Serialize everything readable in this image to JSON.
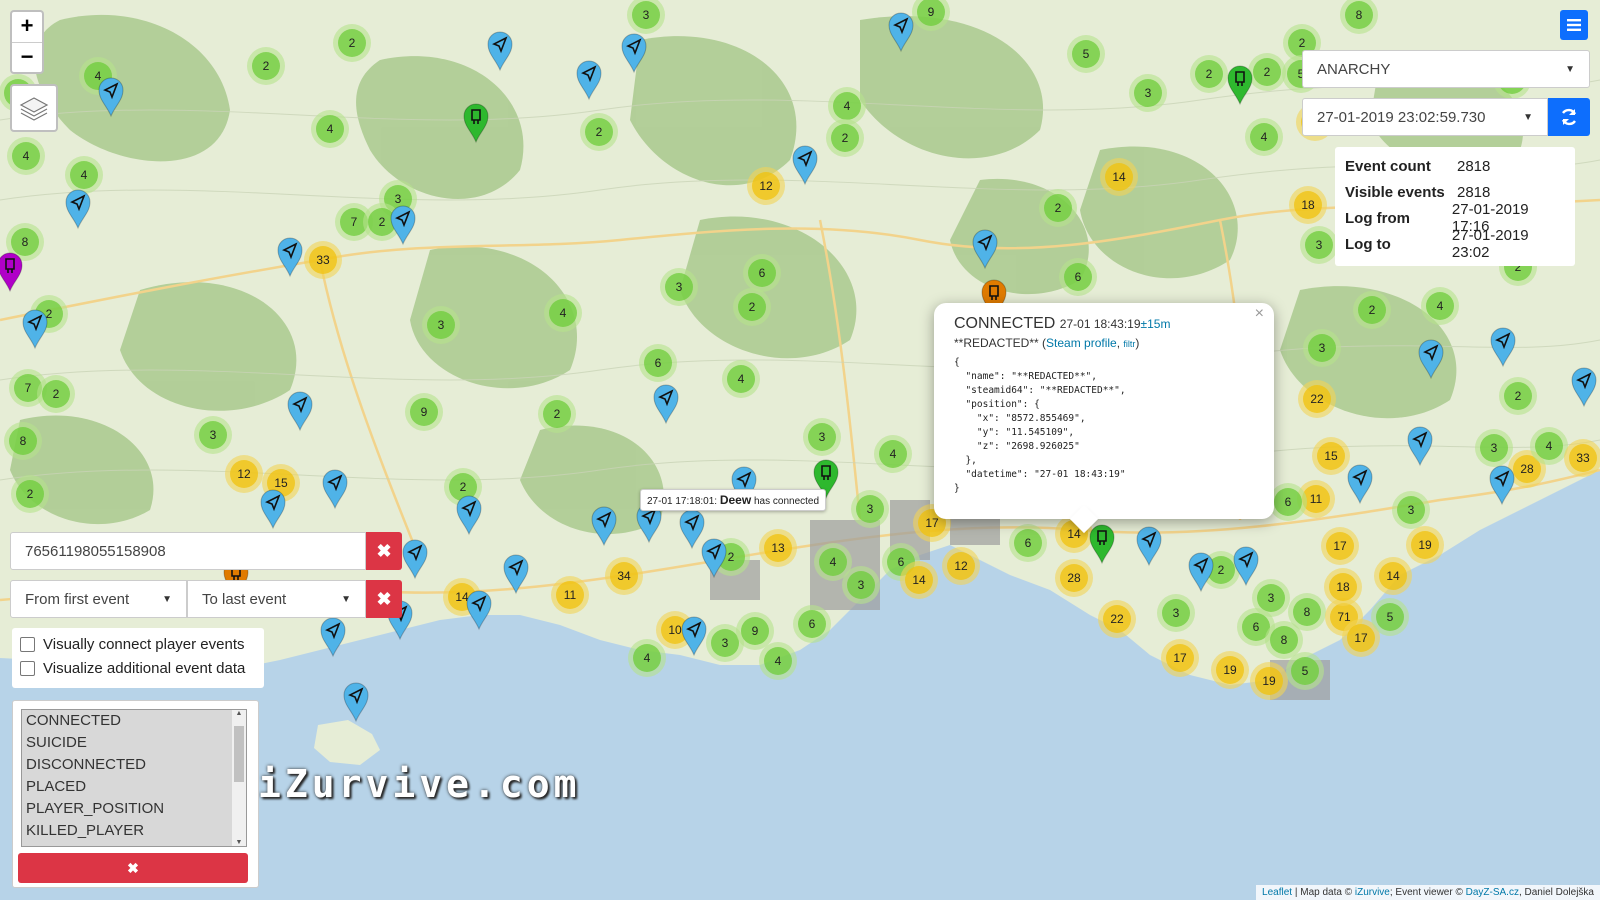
{
  "map": {
    "zoom_in": "+",
    "zoom_out": "−",
    "watermark": "iZurvive.com",
    "sea_color": "#b7d3e8",
    "land_color": "#e6edd6",
    "forest_color": "#a9c98e",
    "clusters": [
      {
        "n": "2"
      },
      {
        "n": "3"
      },
      {
        "n": "9"
      },
      {
        "n": "8"
      },
      {
        "n": "4"
      },
      {
        "n": "2"
      },
      {
        "n": "4"
      },
      {
        "n": "2"
      },
      {
        "n": "5"
      },
      {
        "n": "2"
      },
      {
        "n": "3"
      },
      {
        "n": "4"
      },
      {
        "n": "2"
      },
      {
        "n": "12"
      },
      {
        "n": "14"
      },
      {
        "n": "2"
      },
      {
        "n": "18"
      },
      {
        "n": "3"
      },
      {
        "n": "7"
      },
      {
        "n": "2"
      },
      {
        "n": "33"
      },
      {
        "n": "2"
      },
      {
        "n": "3"
      },
      {
        "n": "3"
      },
      {
        "n": "6"
      },
      {
        "n": "2"
      },
      {
        "n": "4"
      },
      {
        "n": "6"
      },
      {
        "n": "6"
      },
      {
        "n": "4"
      },
      {
        "n": "9"
      },
      {
        "n": "2"
      },
      {
        "n": "3"
      },
      {
        "n": "3"
      },
      {
        "n": "4"
      },
      {
        "n": "12"
      },
      {
        "n": "15"
      },
      {
        "n": "2"
      },
      {
        "n": "3"
      },
      {
        "n": "2"
      },
      {
        "n": "34"
      },
      {
        "n": "13"
      },
      {
        "n": "11"
      },
      {
        "n": "14"
      },
      {
        "n": "10"
      },
      {
        "n": "3"
      },
      {
        "n": "9"
      },
      {
        "n": "6"
      },
      {
        "n": "4"
      },
      {
        "n": "6"
      },
      {
        "n": "4"
      },
      {
        "n": "3"
      },
      {
        "n": "4"
      },
      {
        "n": "17"
      },
      {
        "n": "12"
      },
      {
        "n": "14"
      },
      {
        "n": "6"
      },
      {
        "n": "14"
      },
      {
        "n": "28"
      },
      {
        "n": "22"
      },
      {
        "n": "2"
      },
      {
        "n": "3"
      },
      {
        "n": "3"
      },
      {
        "n": "17"
      },
      {
        "n": "19"
      },
      {
        "n": "19"
      },
      {
        "n": "5"
      },
      {
        "n": "6"
      },
      {
        "n": "8"
      },
      {
        "n": "8"
      },
      {
        "n": "71"
      },
      {
        "n": "17"
      },
      {
        "n": "5"
      },
      {
        "n": "18"
      },
      {
        "n": "14"
      },
      {
        "n": "19"
      },
      {
        "n": "17"
      },
      {
        "n": "11"
      },
      {
        "n": "6"
      },
      {
        "n": "3"
      },
      {
        "n": "15"
      },
      {
        "n": "22"
      },
      {
        "n": "3"
      },
      {
        "n": "2"
      },
      {
        "n": "4"
      },
      {
        "n": "2"
      },
      {
        "n": "3"
      },
      {
        "n": "28"
      },
      {
        "n": "4"
      },
      {
        "n": "33"
      },
      {
        "n": "3"
      },
      {
        "n": "2"
      },
      {
        "n": "2"
      },
      {
        "n": "13"
      },
      {
        "n": "4"
      },
      {
        "n": "2"
      },
      {
        "n": "7"
      },
      {
        "n": "2"
      },
      {
        "n": "8"
      },
      {
        "n": "4"
      },
      {
        "n": "2"
      },
      {
        "n": "8"
      },
      {
        "n": "2"
      },
      {
        "n": "4"
      },
      {
        "n": "5"
      },
      {
        "n": "2"
      },
      {
        "n": "3"
      }
    ]
  },
  "server_select": {
    "value": "ANARCHY"
  },
  "time_select": {
    "value": "27-01-2019 23:02:59.730"
  },
  "stats": [
    {
      "label": "Event count",
      "value": "2818"
    },
    {
      "label": "Visible events",
      "value": "2818"
    },
    {
      "label": "Log from",
      "value": "27-01-2019 17:16"
    },
    {
      "label": "Log to",
      "value": "27-01-2019 23:02"
    }
  ],
  "popup": {
    "event": "CONNECTED",
    "time": "27-01 18:43:19",
    "offset": "±15m",
    "name": "**REDACTED**",
    "steam_link": "Steam profile",
    "filter_link": "filtr",
    "close": "×",
    "json": "{\n  \"name\": \"**REDACTED**\",\n  \"steamid64\": \"**REDACTED**\",\n  \"position\": {\n    \"x\": \"8572.855469\",\n    \"y\": \"11.545109\",\n    \"z\": \"2698.926025\"\n  },\n  \"datetime\": \"27-01 18:43:19\"\n}"
  },
  "tooltip": {
    "time": "27-01 17:18:01:",
    "name": "Deew",
    "text": "has connected"
  },
  "filter": {
    "player_value": "76561198055158908",
    "from_option": "From first event",
    "to_option": "To last event",
    "clear": "✖"
  },
  "checkboxes": [
    {
      "label": "Visually connect player events",
      "checked": false
    },
    {
      "label": "Visualize additional event data",
      "checked": false
    }
  ],
  "event_types": [
    "CONNECTED",
    "SUICIDE",
    "DISCONNECTED",
    "PLACED",
    "PLAYER_POSITION",
    "KILLED_PLAYER"
  ],
  "event_clear": "✖",
  "attribution": {
    "leaflet": "Leaflet",
    "sep1": " | Map data © ",
    "izurvive": "iZurvive",
    "sep2": "; Event viewer © ",
    "dayz": "DayZ-SA.cz",
    "author": ", Daniel Dolejška"
  }
}
